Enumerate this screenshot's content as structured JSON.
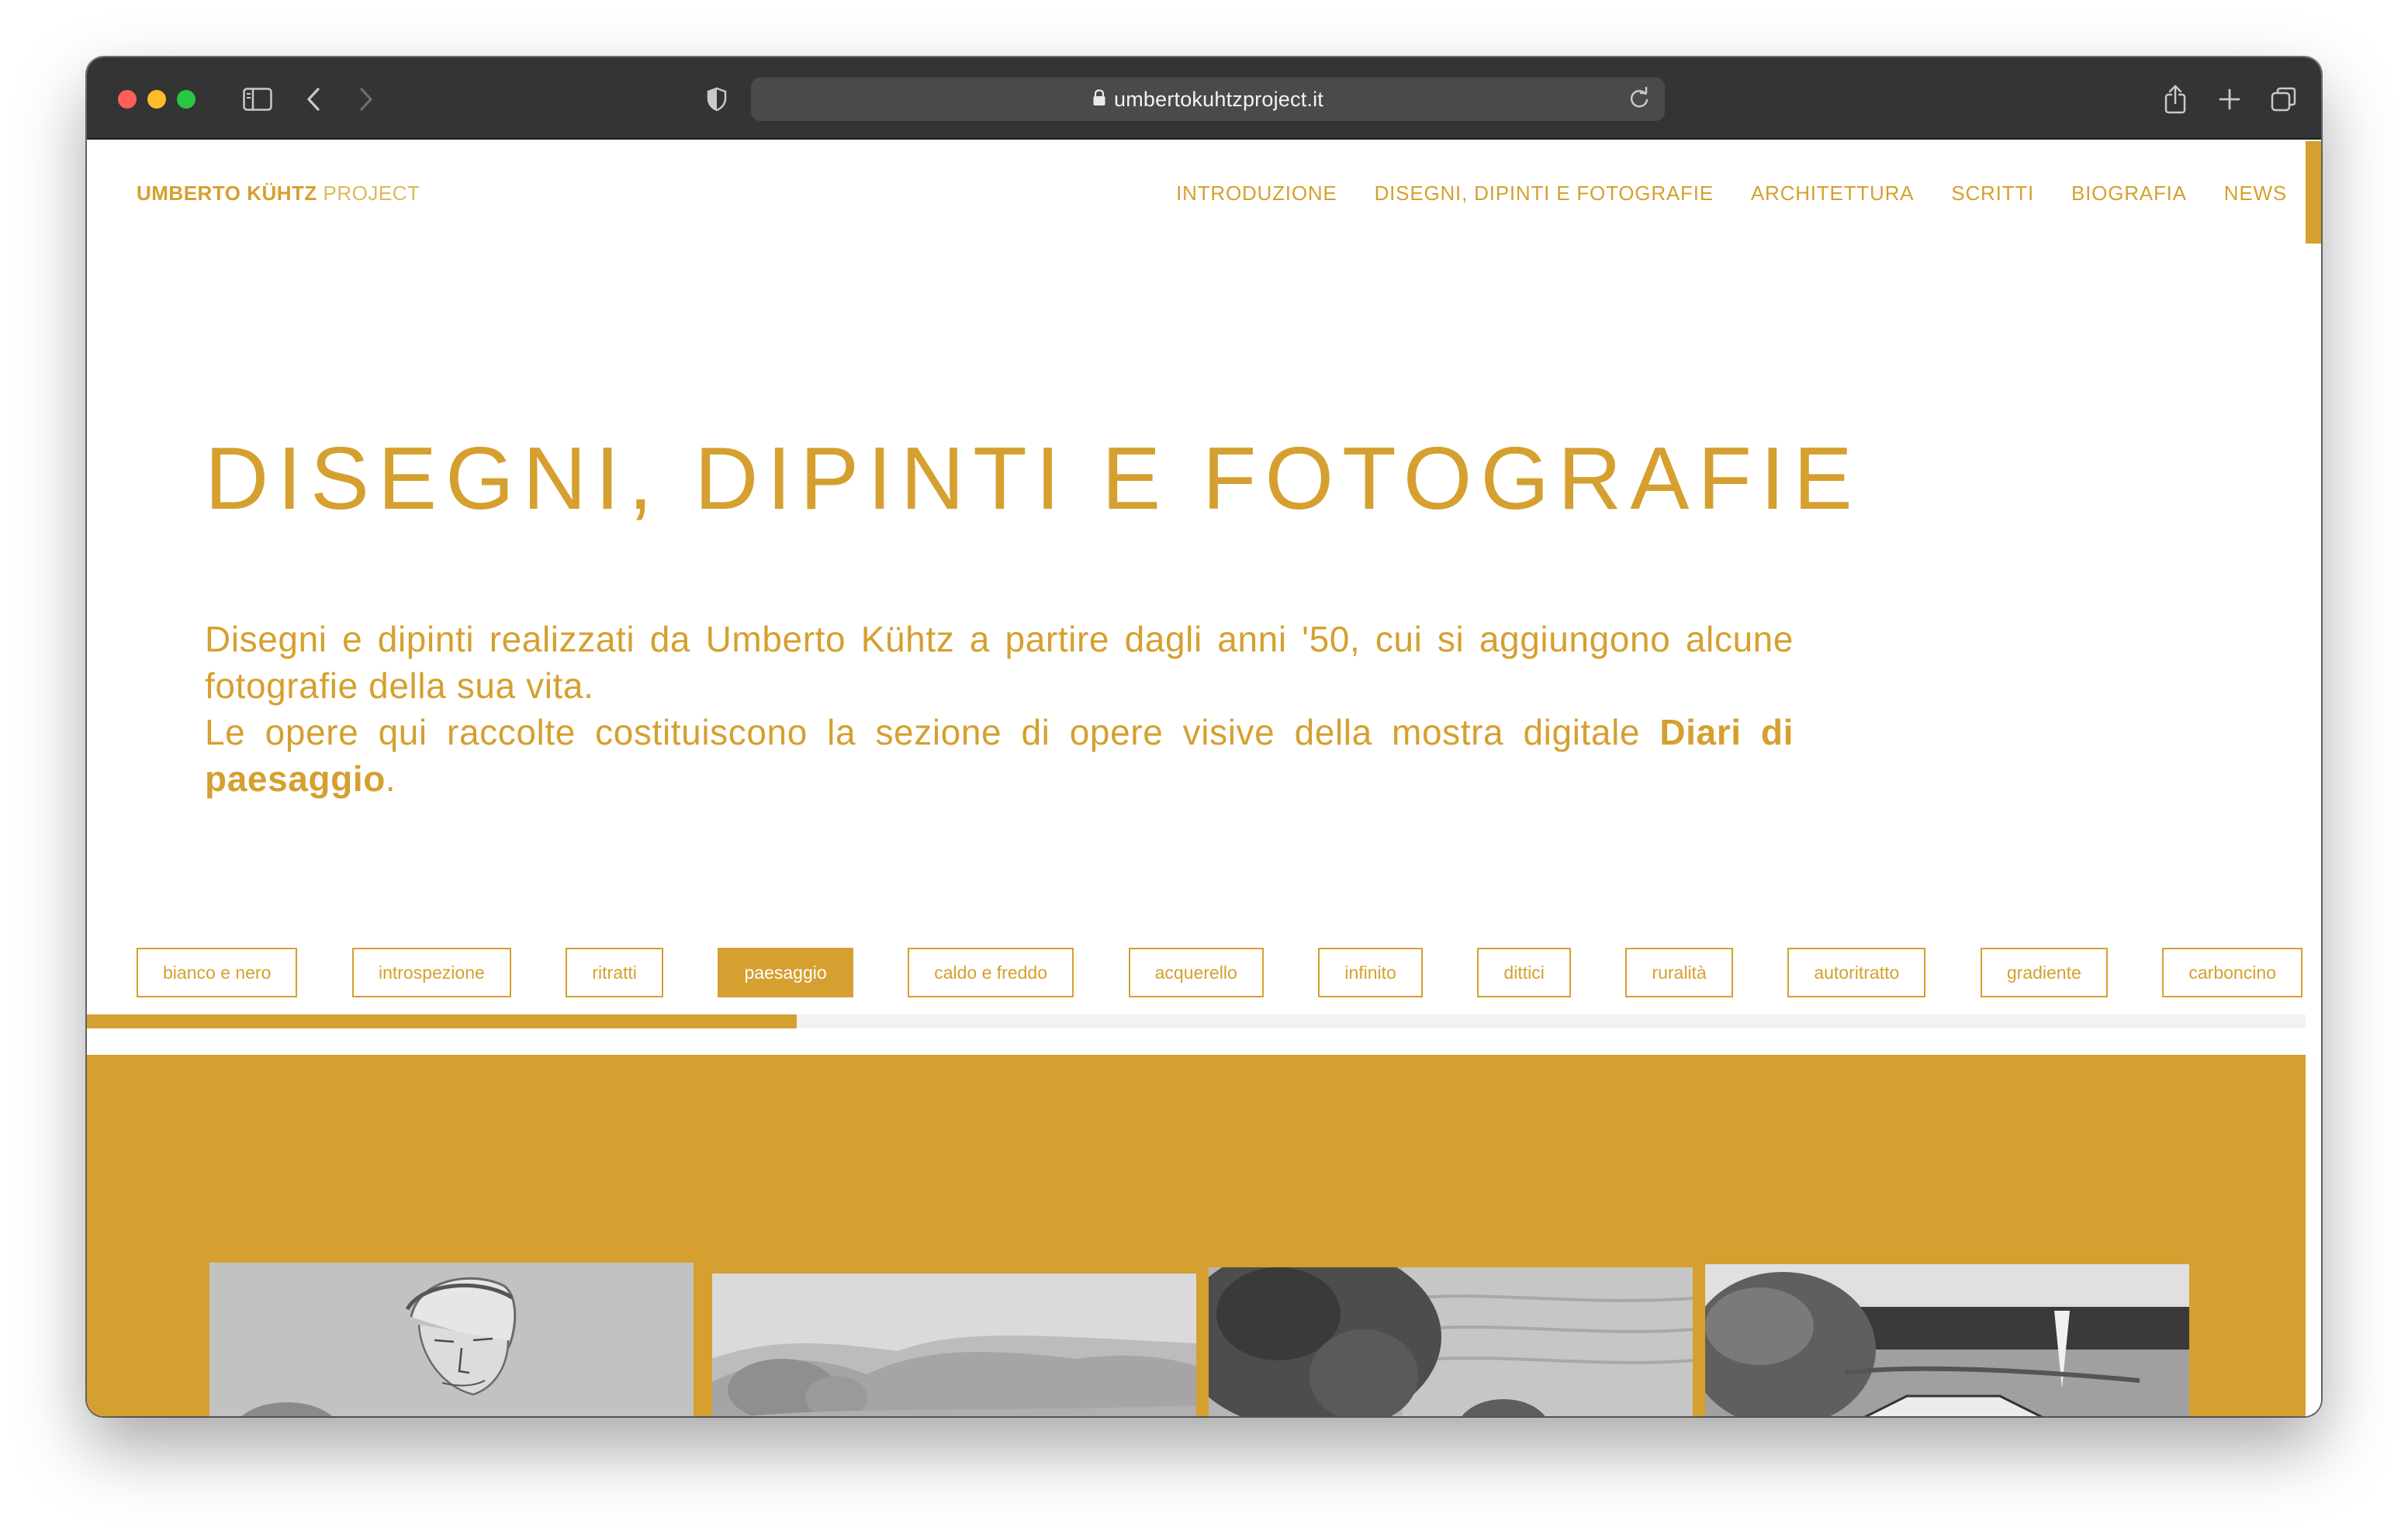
{
  "browser": {
    "url": "umbertokuhtzproject.it"
  },
  "site": {
    "brand_strong": "UMBERTO KÜHTZ",
    "brand_light": "PROJECT",
    "nav": [
      {
        "label": "INTRODUZIONE"
      },
      {
        "label": "DISEGNI, DIPINTI E FOTOGRAFIE"
      },
      {
        "label": "ARCHITETTURA"
      },
      {
        "label": "SCRITTI"
      },
      {
        "label": "BIOGRAFIA"
      },
      {
        "label": "NEWS"
      }
    ]
  },
  "hero": {
    "title": "DISEGNI, DIPINTI E FOTOGRAFIE",
    "paragraph1": "Disegni e dipinti realizzati da Umberto Kühtz a partire dagli anni '50, cui si aggiungono alcune fotografie della sua vita.",
    "paragraph2_text": "Le opere qui raccolte costituiscono la sezione di opere visive della mostra digitale",
    "paragraph2_link": "Diari di paesaggio",
    "paragraph2_end": "."
  },
  "tags": [
    {
      "label": "bianco e nero",
      "active": false
    },
    {
      "label": "introspezione",
      "active": false
    },
    {
      "label": "ritratti",
      "active": false
    },
    {
      "label": "paesaggio",
      "active": true
    },
    {
      "label": "caldo e freddo",
      "active": false
    },
    {
      "label": "acquerello",
      "active": false
    },
    {
      "label": "infinito",
      "active": false
    },
    {
      "label": "dittici",
      "active": false
    },
    {
      "label": "ruralità",
      "active": false
    },
    {
      "label": "autoritratto",
      "active": false
    },
    {
      "label": "gradiente",
      "active": false
    },
    {
      "label": "carboncino",
      "active": false
    }
  ],
  "progress": {
    "fraction": 0.32
  },
  "gallery": {
    "items": [
      {
        "name": "thumb-portrait",
        "icon": "portrait-drawing"
      },
      {
        "name": "thumb-landscape-hills",
        "icon": "landscape-watercolor"
      },
      {
        "name": "thumb-landscape-trees",
        "icon": "landscape-trees"
      },
      {
        "name": "thumb-landscape-house",
        "icon": "landscape-house"
      }
    ]
  },
  "colors": {
    "accent": "#d5a02f",
    "chrome": "#343434",
    "addressbar": "#4a4a4a"
  }
}
